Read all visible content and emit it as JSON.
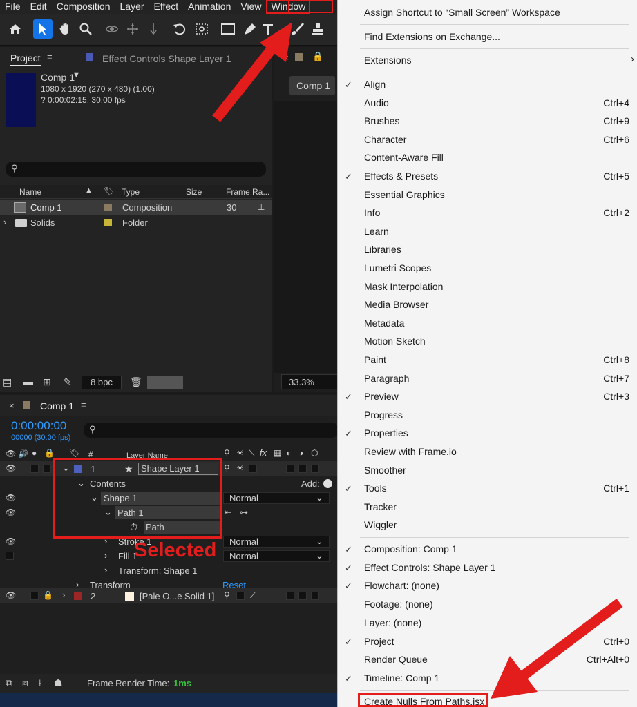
{
  "menubar": {
    "items": [
      "File",
      "Edit",
      "Composition",
      "Layer",
      "Effect",
      "Animation",
      "View",
      "Window"
    ]
  },
  "toolbar": {
    "bpc_label": "8 bpc"
  },
  "project_panel": {
    "tab_label": "Project",
    "effect_controls_tab": "Effect Controls Shape Layer 1",
    "comp_name": "Comp 1",
    "comp_dims": "1080 x 1920  (270 x 480) (1.00)",
    "comp_duration": "? 0:00:02:15, 30.00 fps",
    "columns": [
      "Name",
      "Type",
      "Size",
      "Frame Ra..."
    ],
    "items": [
      {
        "name": "Comp 1",
        "type": "Composition",
        "frame_rate": "30",
        "swatch": "#8a7a62"
      },
      {
        "name": "Solids",
        "type": "Folder",
        "frame_rate": "",
        "swatch": "#c7b53a"
      }
    ]
  },
  "viewer": {
    "tab_label": "Comp 1",
    "zoom": "33.3%"
  },
  "timeline": {
    "tab_label": "Comp 1",
    "timecode": "0:00:00:00",
    "frame_info": "00000 (30.00 fps)",
    "layer_name_header": "Layer Name",
    "hash_header": "#",
    "add_label": "Add:",
    "reset_label": "Reset",
    "rows": {
      "layer1_num": "1",
      "layer1_name": "Shape Layer 1",
      "contents": "Contents",
      "shape1": "Shape 1",
      "path1": "Path 1",
      "path": "Path",
      "stroke1": "Stroke 1",
      "fill1": "Fill 1",
      "transform_shape1": "Transform: Shape 1",
      "transform": "Transform",
      "layer2_num": "2",
      "layer2_name": "[Pale O...e Solid 1]",
      "blend_normal": "Normal"
    },
    "render_time_label": "Frame Render Time:",
    "render_time_value": "1ms"
  },
  "annotation": {
    "selected_label": "Selected"
  },
  "window_menu": {
    "top_items": [
      {
        "label": "Assign Shortcut to “Small Screen” Workspace"
      },
      {
        "label": "Find Extensions on Exchange..."
      },
      {
        "label": "Extensions",
        "submenu": true
      }
    ],
    "panel_items": [
      {
        "label": "Align",
        "checked": true,
        "shortcut": ""
      },
      {
        "label": "Audio",
        "checked": false,
        "shortcut": "Ctrl+4"
      },
      {
        "label": "Brushes",
        "checked": false,
        "shortcut": "Ctrl+9"
      },
      {
        "label": "Character",
        "checked": false,
        "shortcut": "Ctrl+6"
      },
      {
        "label": "Content-Aware Fill",
        "checked": false,
        "shortcut": ""
      },
      {
        "label": "Effects & Presets",
        "checked": true,
        "shortcut": "Ctrl+5"
      },
      {
        "label": "Essential Graphics",
        "checked": false,
        "shortcut": ""
      },
      {
        "label": "Info",
        "checked": false,
        "shortcut": "Ctrl+2"
      },
      {
        "label": "Learn",
        "checked": false,
        "shortcut": ""
      },
      {
        "label": "Libraries",
        "checked": false,
        "shortcut": ""
      },
      {
        "label": "Lumetri Scopes",
        "checked": false,
        "shortcut": ""
      },
      {
        "label": "Mask Interpolation",
        "checked": false,
        "shortcut": ""
      },
      {
        "label": "Media Browser",
        "checked": false,
        "shortcut": ""
      },
      {
        "label": "Metadata",
        "checked": false,
        "shortcut": ""
      },
      {
        "label": "Motion Sketch",
        "checked": false,
        "shortcut": ""
      },
      {
        "label": "Paint",
        "checked": false,
        "shortcut": "Ctrl+8"
      },
      {
        "label": "Paragraph",
        "checked": false,
        "shortcut": "Ctrl+7"
      },
      {
        "label": "Preview",
        "checked": true,
        "shortcut": "Ctrl+3"
      },
      {
        "label": "Progress",
        "checked": false,
        "shortcut": ""
      },
      {
        "label": "Properties",
        "checked": true,
        "shortcut": ""
      },
      {
        "label": "Review with Frame.io",
        "checked": false,
        "shortcut": ""
      },
      {
        "label": "Smoother",
        "checked": false,
        "shortcut": ""
      },
      {
        "label": "Tools",
        "checked": true,
        "shortcut": "Ctrl+1"
      },
      {
        "label": "Tracker",
        "checked": false,
        "shortcut": ""
      },
      {
        "label": "Wiggler",
        "checked": false,
        "shortcut": ""
      }
    ],
    "window_items": [
      {
        "label": "Composition: Comp 1",
        "checked": true,
        "shortcut": ""
      },
      {
        "label": "Effect Controls: Shape Layer 1",
        "checked": true,
        "shortcut": ""
      },
      {
        "label": "Flowchart: (none)",
        "checked": true,
        "shortcut": ""
      },
      {
        "label": "Footage: (none)",
        "checked": false,
        "shortcut": ""
      },
      {
        "label": "Layer: (none)",
        "checked": false,
        "shortcut": ""
      },
      {
        "label": "Project",
        "checked": true,
        "shortcut": "Ctrl+0"
      },
      {
        "label": "Render Queue",
        "checked": false,
        "shortcut": "Ctrl+Alt+0"
      },
      {
        "label": "Timeline: Comp 1",
        "checked": true,
        "shortcut": ""
      }
    ],
    "script_item": {
      "label": "Create Nulls From Paths.jsx"
    }
  },
  "colors": {
    "accent_blue": "#1473e6",
    "annotation_red": "#e31c1c",
    "timecode_blue": "#2e9bff",
    "layer1_label": "#4f5fc0",
    "layer2_label": "#9c2626",
    "render_time_green": "#38c13a"
  }
}
